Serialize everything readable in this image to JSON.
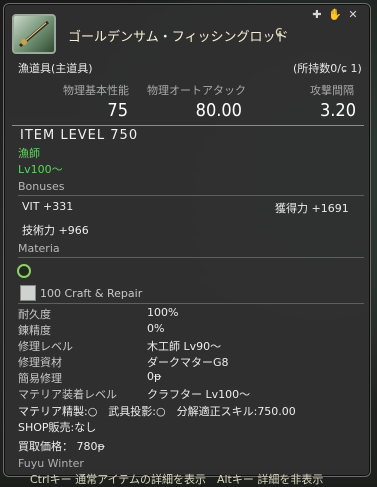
{
  "item": {
    "name": "ゴールデンサム・フィッシングロッド",
    "collect_icon": "collectable-icon",
    "category": "漁道具(主道具)",
    "owned": "(所持数0/",
    "owned_suffix": " 1)"
  },
  "stats": {
    "headers": [
      "物理基本性能",
      "物理オートアタック",
      "攻撃間隔"
    ],
    "values": [
      "75",
      "80.00",
      "3.20"
    ]
  },
  "item_level": "ITEM LEVEL 750",
  "job": "漁師",
  "level": "Lv100〜",
  "bonuses": {
    "title": "Bonuses",
    "vit": "VIT +331",
    "gathering": "獲得力 +1691",
    "tech": "技術力 +966"
  },
  "materia": {
    "title": "Materia"
  },
  "craft_repair": {
    "title": "100 Craft & Repair"
  },
  "details": [
    {
      "label": "耐久度",
      "value": "100%"
    },
    {
      "label": "錬精度",
      "value": "0%"
    },
    {
      "label": "修理レベル",
      "value": "木工師 Lv90〜"
    },
    {
      "label": "修理資材",
      "value": "ダークマターG8"
    },
    {
      "label": "簡易修理",
      "value": "0ᵽ"
    },
    {
      "label": "マテリア装着レベル",
      "value": "クラフター Lv100〜"
    }
  ],
  "flags": {
    "line1": "マテリア精製:○　武具投影:○　分解適正スキル:750.00",
    "line2": "SHOP販売:なし"
  },
  "purchase": "買取価格： 780ᵽ",
  "crafter": "Fuyu Winter",
  "hint": "Ctrlキー 通常アイテムの詳細を表示　Altキー 詳細を非表示",
  "colors": {
    "accent_green": "#5fd35f",
    "panel": "#303030"
  }
}
